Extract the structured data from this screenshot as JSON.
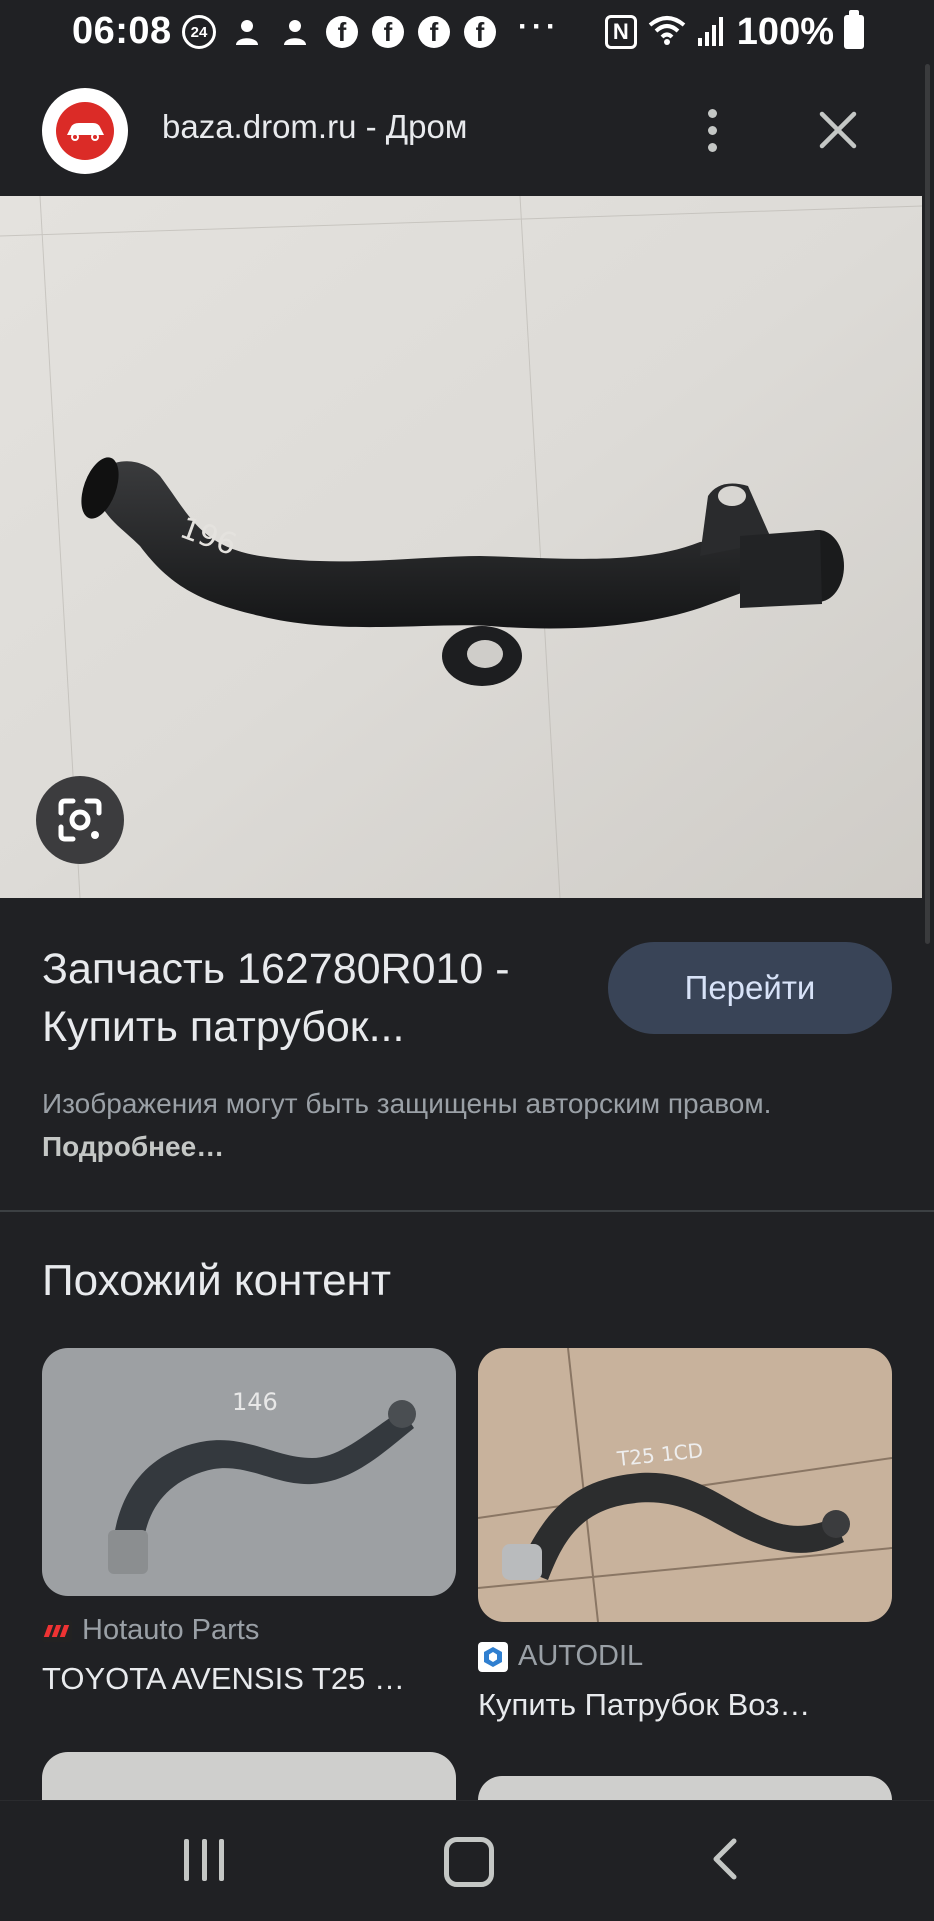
{
  "status_bar": {
    "time": "06:08",
    "notification_badge": "24",
    "battery": "100%",
    "icons": [
      "person-icon",
      "person-icon",
      "facebook-icon",
      "facebook-icon",
      "facebook-icon",
      "facebook-icon",
      "more-dots-icon",
      "nfc-icon",
      "wifi-icon",
      "signal-icon",
      "battery-icon"
    ]
  },
  "header": {
    "site_title": "baza.drom.ru - Дром",
    "logo_icon": "drom-logo",
    "menu_icon": "more-vert-icon",
    "close_icon": "close-icon"
  },
  "result": {
    "title": "Запчасть 162780R010 - Купить патрубок...",
    "go_button": "Перейти",
    "copyright_text": "Изображения могут быть защищены авторским правом.",
    "copyright_link": "Подробнее…",
    "image_annotation": "196"
  },
  "similar": {
    "heading": "Похожий контент",
    "items": [
      {
        "source": "Hotauto Parts",
        "caption": "TOYOTA AVENSIS T25 …",
        "image_annotation": "146"
      },
      {
        "source": "AUTODIL",
        "caption": "Купить Патрубок Воз…",
        "image_annotation": "T25 1CD"
      }
    ]
  },
  "colors": {
    "background": "#202124",
    "go_button_bg": "#394457",
    "text_primary": "#e8eaed",
    "text_secondary": "#9aa0a6",
    "drom_red": "#db2b27"
  }
}
